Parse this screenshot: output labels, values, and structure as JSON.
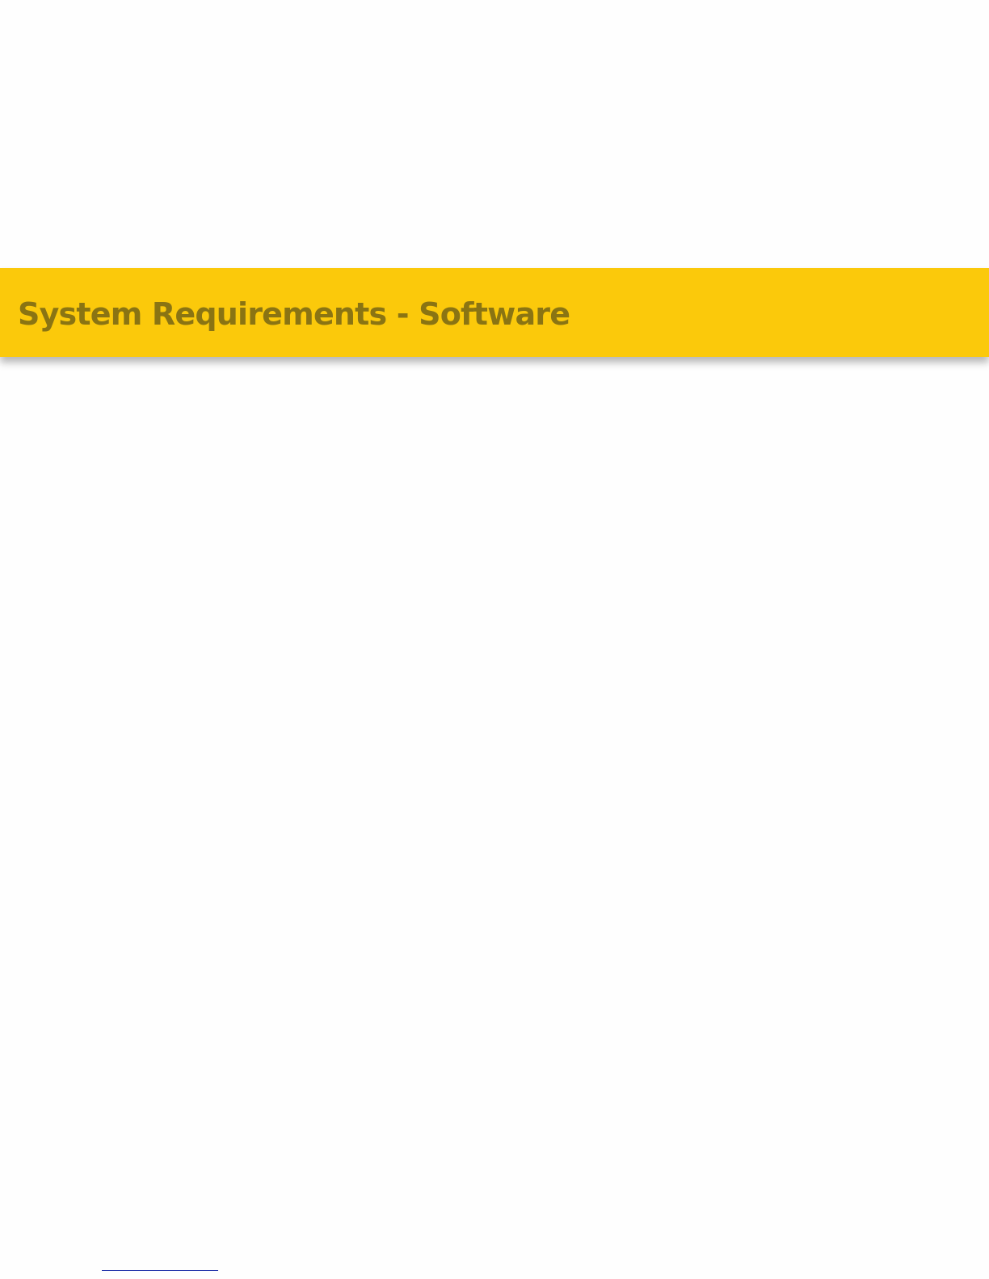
{
  "banner": {
    "title": "System Requirements - Software",
    "background_color": "#fbc90b",
    "text_color": "#8a7413"
  },
  "footnote_rule_color": "#2233aa"
}
